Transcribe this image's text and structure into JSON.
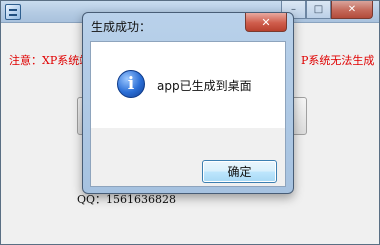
{
  "main_window": {
    "caption_buttons": [
      "–",
      "□",
      "✕"
    ],
    "warning_left": "注意：XP系统端",
    "warning_right": "P系统无法生成",
    "qq_text": "QQ：1561636828"
  },
  "dialog": {
    "title": "生成成功：",
    "close_symbol": "✕",
    "icon_glyph": "i",
    "message": "app已生成到桌面",
    "ok_label": "确定"
  }
}
